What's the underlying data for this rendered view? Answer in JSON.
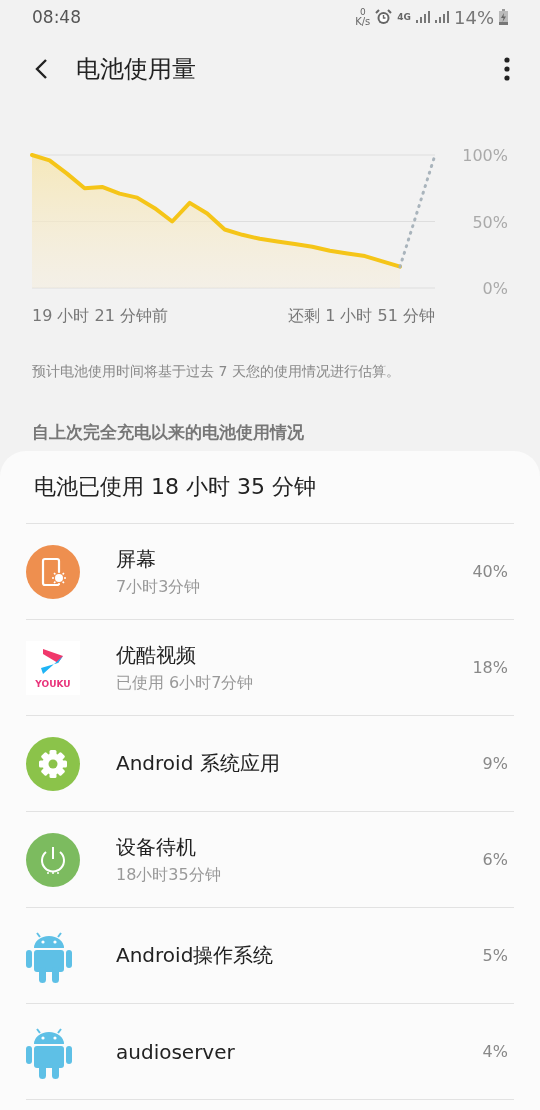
{
  "status_bar": {
    "time": "08:48",
    "net_speed": "0",
    "net_unit": "K/s",
    "network": "4G",
    "battery": "14%"
  },
  "header": {
    "title": "电池使用量"
  },
  "chart_data": {
    "type": "area",
    "ylim": [
      0,
      100
    ],
    "yticks": [
      {
        "value": 100,
        "label": "100%"
      },
      {
        "value": 50,
        "label": "50%"
      },
      {
        "value": 0,
        "label": "0%"
      }
    ],
    "series": [
      {
        "color": "#f5c518",
        "type": "area",
        "line_style": "solid",
        "values": [
          100,
          96,
          86,
          75,
          76,
          71,
          68,
          60,
          50,
          64,
          56,
          44,
          40,
          37,
          35,
          33,
          31,
          28,
          26,
          24,
          20,
          16,
          null,
          null
        ]
      },
      {
        "color": "#a9b4bc",
        "type": "line",
        "line_style": "dashed",
        "values": [
          null,
          null,
          null,
          null,
          null,
          null,
          null,
          null,
          null,
          null,
          null,
          null,
          null,
          null,
          null,
          null,
          null,
          null,
          null,
          null,
          null,
          16,
          58,
          100
        ]
      }
    ]
  },
  "range_start": "19 小时 21 分钟前",
  "range_end": "还剩 1 小时 51 分钟",
  "note": "预计电池使用时间将基于过去 7 天您的使用情况进行估算。",
  "section_title": "自上次完全充电以来的电池使用情况",
  "usage": {
    "total": "电池已使用 18 小时 35 分钟",
    "items": [
      {
        "kind": "screen",
        "name": "屏幕",
        "detail": "7小时3分钟",
        "percent": "40%"
      },
      {
        "kind": "youku",
        "icon_text": "YOUKU",
        "name": "优酷视频",
        "detail": "已使用 6小时7分钟",
        "percent": "18%"
      },
      {
        "kind": "gear",
        "name": "Android 系统应用",
        "percent": "9%"
      },
      {
        "kind": "power",
        "name": "设备待机",
        "detail": "18小时35分钟",
        "percent": "6%"
      },
      {
        "kind": "android",
        "name": "Android操作系统",
        "percent": "5%"
      },
      {
        "kind": "android",
        "name": "audioserver",
        "percent": "4%"
      }
    ]
  }
}
